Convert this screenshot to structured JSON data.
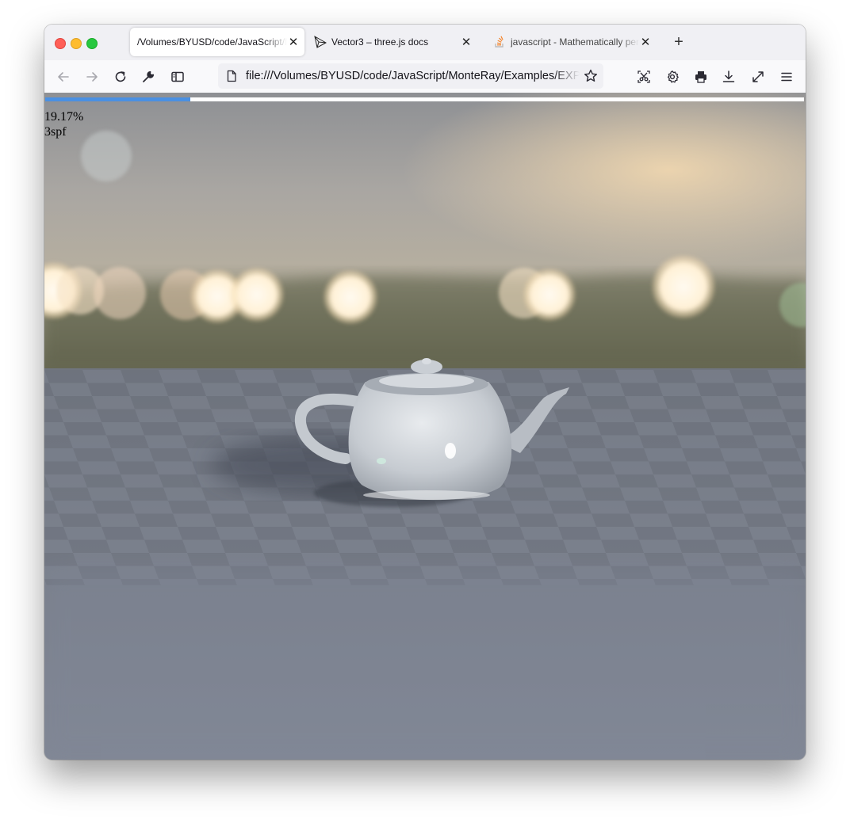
{
  "browser": {
    "tabs": [
      {
        "label": "/Volumes/BYUSD/code/JavaScript/MonteRay/Examples/EXPERIMENTAL",
        "active": true,
        "favicon": "none"
      },
      {
        "label": "Vector3 – three.js docs",
        "active": false,
        "favicon": "threejs-icon"
      },
      {
        "label": "javascript - Mathematically perfect",
        "active": false,
        "favicon": "stackoverflow-icon"
      }
    ],
    "address": "file:///Volumes/BYUSD/code/JavaScript/MonteRay/Examples/EXPERIMENTAL",
    "toolbar_icons": [
      "back-icon",
      "forward-icon",
      "reload-icon",
      "wrench-icon",
      "sidebar-icon",
      "page-icon",
      "bookmark-star-icon",
      "screenshot-icon",
      "settings-icon",
      "print-icon",
      "download-icon",
      "fullscreen-icon",
      "menu-icon"
    ]
  },
  "page": {
    "progress_text": "19.17%",
    "progress_fraction": 0.1917,
    "spf_text": "3spf",
    "progress_color": "#4a90e2"
  }
}
